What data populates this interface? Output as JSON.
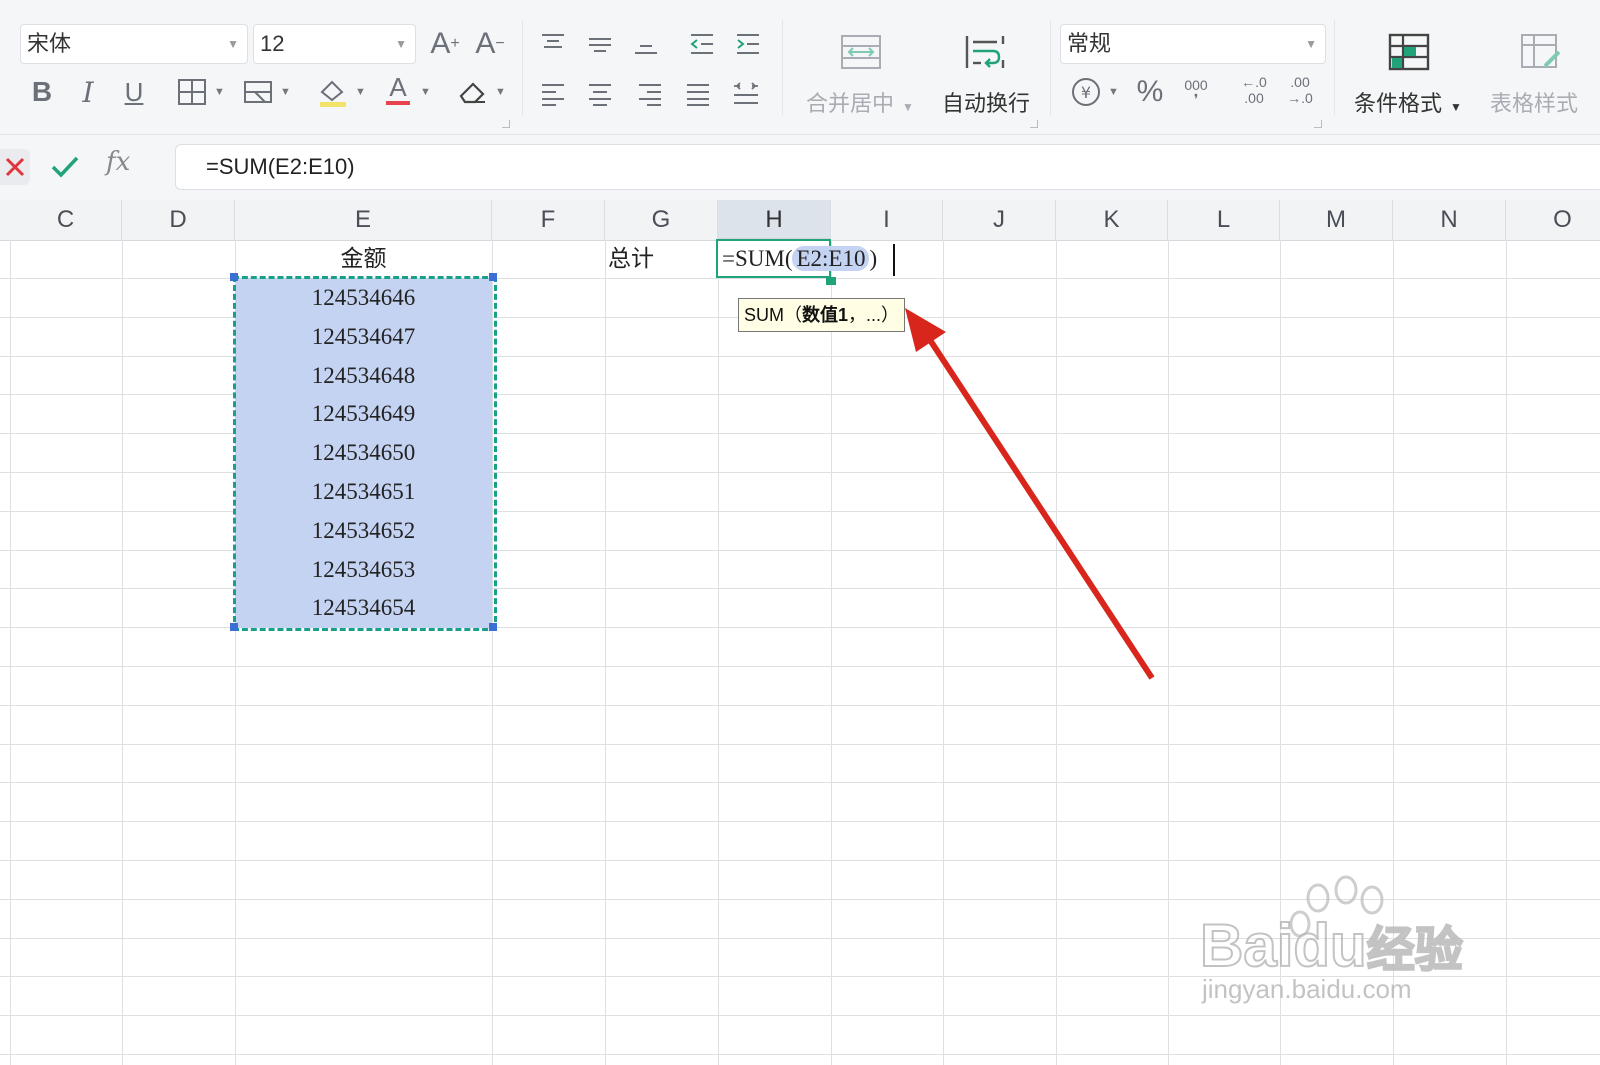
{
  "ribbon": {
    "font_name": "宋体",
    "font_size": "12",
    "merge_center_label": "合并居中",
    "wrap_text_label": "自动换行",
    "number_format": "常规",
    "thousands_top": "000",
    "dec_inc_top": "←.0",
    "dec_inc_bottom": ".00",
    "dec_dec_top": ".00",
    "dec_dec_bottom": "→.0",
    "conditional_format_label": "条件格式",
    "table_style_label": "表格样式"
  },
  "formula_bar": {
    "fx_label": "fx",
    "formula": "=SUM(E2:E10)"
  },
  "sheet": {
    "columns": [
      "C",
      "D",
      "E",
      "F",
      "G",
      "H",
      "I",
      "J",
      "K",
      "L",
      "M",
      "N",
      "O"
    ],
    "active_column": "H",
    "e_header": "金额",
    "e_values": [
      "124534646",
      "124534647",
      "124534648",
      "124534649",
      "124534650",
      "124534651",
      "124534652",
      "124534653",
      "124534654"
    ],
    "g_label": "总计",
    "h_prefix": "=SUM(",
    "h_range": "E2:E10",
    "h_suffix": ")",
    "tooltip_fn": "SUM（",
    "tooltip_arg": "数值1",
    "tooltip_rest": "，...）"
  },
  "watermark": {
    "brand": "Bai",
    "brand2": "du",
    "brand_cn": "经验",
    "url": "jingyan.baidu.com"
  },
  "colors": {
    "accent_green": "#20a27a",
    "selection_fill": "#c5d3f3",
    "arrow_red": "#d9261c"
  }
}
